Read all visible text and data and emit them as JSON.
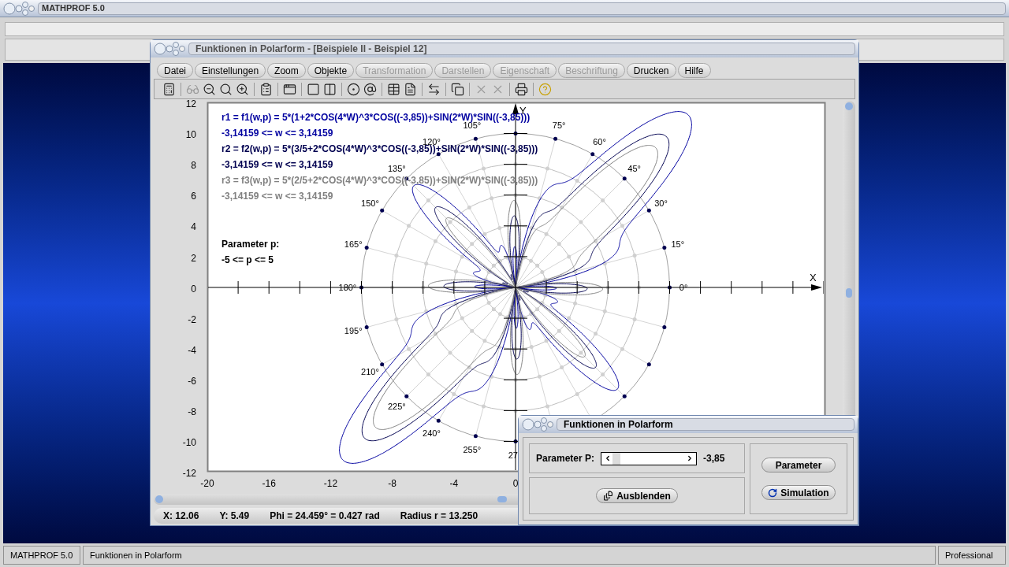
{
  "app_title": "MATHPROF 5.0",
  "window": {
    "title": "Funktionen in Polarform - [Beispiele II - Beispiel 12]",
    "menu": [
      {
        "label": "Datei",
        "disabled": false
      },
      {
        "label": "Einstellungen",
        "disabled": false
      },
      {
        "label": "Zoom",
        "disabled": false
      },
      {
        "label": "Objekte",
        "disabled": false
      },
      {
        "label": "Transformation",
        "disabled": true
      },
      {
        "label": "Darstellen",
        "disabled": true
      },
      {
        "label": "Eigenschaft",
        "disabled": true
      },
      {
        "label": "Beschriftung",
        "disabled": true
      },
      {
        "label": "Drucken",
        "disabled": false
      },
      {
        "label": "Hilfe",
        "disabled": false
      }
    ],
    "toolbar": [
      [
        {
          "kind": "calculator",
          "disabled": false
        }
      ],
      [
        {
          "kind": "glasses",
          "disabled": true
        },
        {
          "kind": "zoom-out",
          "disabled": false
        },
        {
          "kind": "zoom-reset",
          "disabled": false
        },
        {
          "kind": "zoom-in",
          "disabled": false
        }
      ],
      [
        {
          "kind": "properties",
          "disabled": false
        }
      ],
      [
        {
          "kind": "window",
          "disabled": false
        }
      ],
      [
        {
          "kind": "square",
          "disabled": false
        },
        {
          "kind": "columns",
          "disabled": false
        }
      ],
      [
        {
          "kind": "circle-dot",
          "disabled": false
        },
        {
          "kind": "at",
          "disabled": false
        }
      ],
      [
        {
          "kind": "table",
          "disabled": false
        },
        {
          "kind": "document",
          "disabled": false
        }
      ],
      [
        {
          "kind": "swap",
          "disabled": false
        }
      ],
      [
        {
          "kind": "pages",
          "disabled": false
        }
      ],
      [
        {
          "kind": "cross",
          "disabled": true
        },
        {
          "kind": "cross",
          "disabled": true
        }
      ],
      [
        {
          "kind": "printer",
          "disabled": false
        }
      ],
      [
        {
          "kind": "help",
          "disabled": false
        }
      ]
    ],
    "plot": {
      "functions": [
        {
          "formula": "r1 = f1(w,p) = 5*(1+2*COS(4*W)^3*COS((-3,85))+SIN(2*W)*SIN((-3,85)))",
          "range": "-3,14159 <= w <= 3,14159",
          "color": "#0000a0"
        },
        {
          "formula": "r2 = f2(w,p) = 5*(3/5+2*COS(4*W)^3*COS((-3,85))+SIN(2*W)*SIN((-3,85)))",
          "range": "-3,14159 <= w <= 3,14159",
          "color": "#000050"
        },
        {
          "formula": "r3 = f3(w,p) = 5*(2/5+2*COS(4*W)^3*COS((-3,85))+SIN(2*W)*SIN((-3,85)))",
          "range": "-3,14159 <= w <= 3,14159",
          "color": "#808080"
        }
      ],
      "parameter_label": "Parameter p:",
      "parameter_range": "-5 <= p <= 5",
      "x_axis_label": "X",
      "y_axis_label": "Y",
      "y_ticks": [
        "12",
        "10",
        "8",
        "6",
        "4",
        "2",
        "0",
        "-2",
        "-4",
        "-6",
        "-8",
        "-10",
        "-12"
      ],
      "x_ticks": [
        "-20",
        "-16",
        "-12",
        "-8",
        "-4",
        "0"
      ],
      "angle_labels": [
        "0°",
        "15°",
        "30°",
        "45°",
        "60°",
        "75°",
        "105°",
        "120°",
        "135°",
        "150°",
        "165°",
        "180°",
        "195°",
        "210°",
        "225°",
        "240°",
        "255°",
        "27"
      ]
    },
    "status": [
      "X: 12.06",
      "Y: 5.49",
      "Phi = 24.459° = 0.427 rad",
      "Radius r = 13.250"
    ]
  },
  "dialog": {
    "title": "Funktionen in Polarform",
    "slider_label": "Parameter P:",
    "level": 0.115,
    "reading": "-3,85",
    "hide_button": "Ausblenden",
    "parameter_button": "Parameter",
    "simulation_button": "Simulation"
  },
  "status_bar": [
    "MATHPROF 5.0",
    "Funktionen in Polarform",
    "Professional"
  ]
}
